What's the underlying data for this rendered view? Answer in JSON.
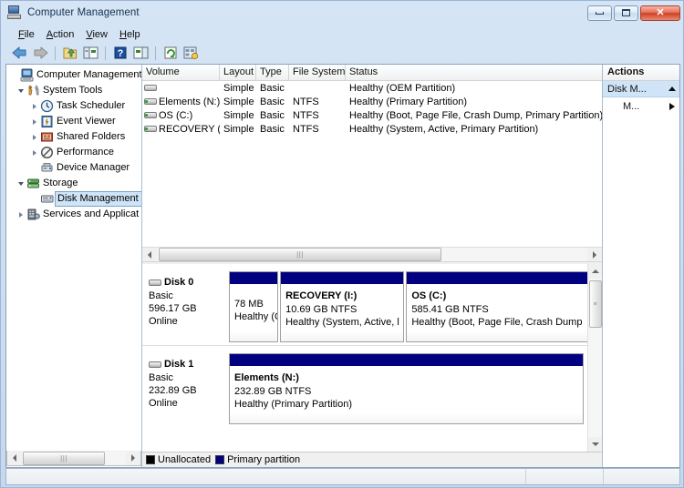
{
  "window": {
    "title": "Computer Management",
    "icon": "computer-management-icon",
    "buttons": {
      "minimize": "minimize-icon",
      "maximize": "maximize-icon",
      "close": "close-icon"
    }
  },
  "menu": {
    "items": [
      {
        "label": "File",
        "accel": "F"
      },
      {
        "label": "Action",
        "accel": "A"
      },
      {
        "label": "View",
        "accel": "V"
      },
      {
        "label": "Help",
        "accel": "H"
      }
    ]
  },
  "toolbar": {
    "items": [
      {
        "name": "back-arrow-icon"
      },
      {
        "name": "forward-arrow-icon"
      },
      {
        "name": "up-folder-icon"
      },
      {
        "name": "show-hide-console-tree-icon"
      },
      {
        "name": "help-icon"
      },
      {
        "name": "show-hide-action-pane-icon"
      },
      {
        "name": "refresh-icon"
      },
      {
        "name": "export-list-icon"
      }
    ]
  },
  "tree": {
    "root": {
      "label": "Computer Management",
      "icon": "computer-icon"
    },
    "items": [
      {
        "label": "System Tools",
        "icon": "system-tools-icon",
        "indent": 1,
        "twisty": "expanded"
      },
      {
        "label": "Task Scheduler",
        "icon": "task-scheduler-icon",
        "indent": 2,
        "twisty": "collapsed"
      },
      {
        "label": "Event Viewer",
        "icon": "event-viewer-icon",
        "indent": 2,
        "twisty": "collapsed"
      },
      {
        "label": "Shared Folders",
        "icon": "shared-folders-icon",
        "indent": 2,
        "twisty": "collapsed"
      },
      {
        "label": "Performance",
        "icon": "performance-icon",
        "indent": 2,
        "twisty": "collapsed"
      },
      {
        "label": "Device Manager",
        "icon": "device-manager-icon",
        "indent": 2,
        "twisty": "none"
      },
      {
        "label": "Storage",
        "icon": "storage-icon",
        "indent": 1,
        "twisty": "expanded"
      },
      {
        "label": "Disk Management",
        "icon": "disk-management-icon",
        "indent": 2,
        "twisty": "none",
        "selected": true
      },
      {
        "label": "Services and Applicat",
        "icon": "services-icon",
        "indent": 1,
        "twisty": "collapsed"
      }
    ]
  },
  "volume_list": {
    "columns": [
      "Volume",
      "Layout",
      "Type",
      "File System",
      "Status"
    ],
    "rows": [
      {
        "volume": "",
        "layout": "Simple",
        "type": "Basic",
        "filesystem": "",
        "status": "Healthy (OEM Partition)"
      },
      {
        "volume": "Elements (N:)",
        "layout": "Simple",
        "type": "Basic",
        "filesystem": "NTFS",
        "status": "Healthy (Primary Partition)"
      },
      {
        "volume": "OS (C:)",
        "layout": "Simple",
        "type": "Basic",
        "filesystem": "NTFS",
        "status": "Healthy (Boot, Page File, Crash Dump, Primary Partition)"
      },
      {
        "volume": "RECOVERY (I:)",
        "layout": "Simple",
        "type": "Basic",
        "filesystem": "NTFS",
        "status": "Healthy (System, Active, Primary Partition)"
      }
    ]
  },
  "graphical_view": {
    "disks": [
      {
        "name": "Disk 0",
        "type": "Basic",
        "capacity": "596.17 GB",
        "state": "Online",
        "partitions": [
          {
            "name": "",
            "size": "78 MB",
            "status": "Healthy (C",
            "width_pct": 13.5,
            "kind": "oem"
          },
          {
            "name": "RECOVERY  (I:)",
            "size": "10.69 GB NTFS",
            "status": "Healthy (System, Active, l",
            "width_pct": 34,
            "kind": "primary"
          },
          {
            "name": "OS  (C:)",
            "size": "585.41 GB NTFS",
            "status": "Healthy (Boot, Page File, Crash Dump",
            "width_pct": 52.5,
            "kind": "primary"
          }
        ]
      },
      {
        "name": "Disk 1",
        "type": "Basic",
        "capacity": "232.89 GB",
        "state": "Online",
        "partitions": [
          {
            "name": "Elements  (N:)",
            "size": "232.89 GB NTFS",
            "status": "Healthy (Primary Partition)",
            "width_pct": 100,
            "kind": "primary"
          }
        ]
      }
    ]
  },
  "legend": {
    "items": [
      {
        "label": "Unallocated",
        "swatch": "#000000"
      },
      {
        "label": "Primary partition",
        "swatch": "#000080"
      }
    ]
  },
  "actions": {
    "title": "Actions",
    "group": {
      "label": "Disk M...",
      "toggle": "collapse-caret-icon"
    },
    "items": [
      {
        "label": "M...",
        "submenu": "submenu-caret-icon"
      }
    ]
  },
  "colors": {
    "partition_bar": "#000080",
    "unallocated": "#000000",
    "selection": "#cfe4f7",
    "window_frame": "#b9d1ea"
  }
}
